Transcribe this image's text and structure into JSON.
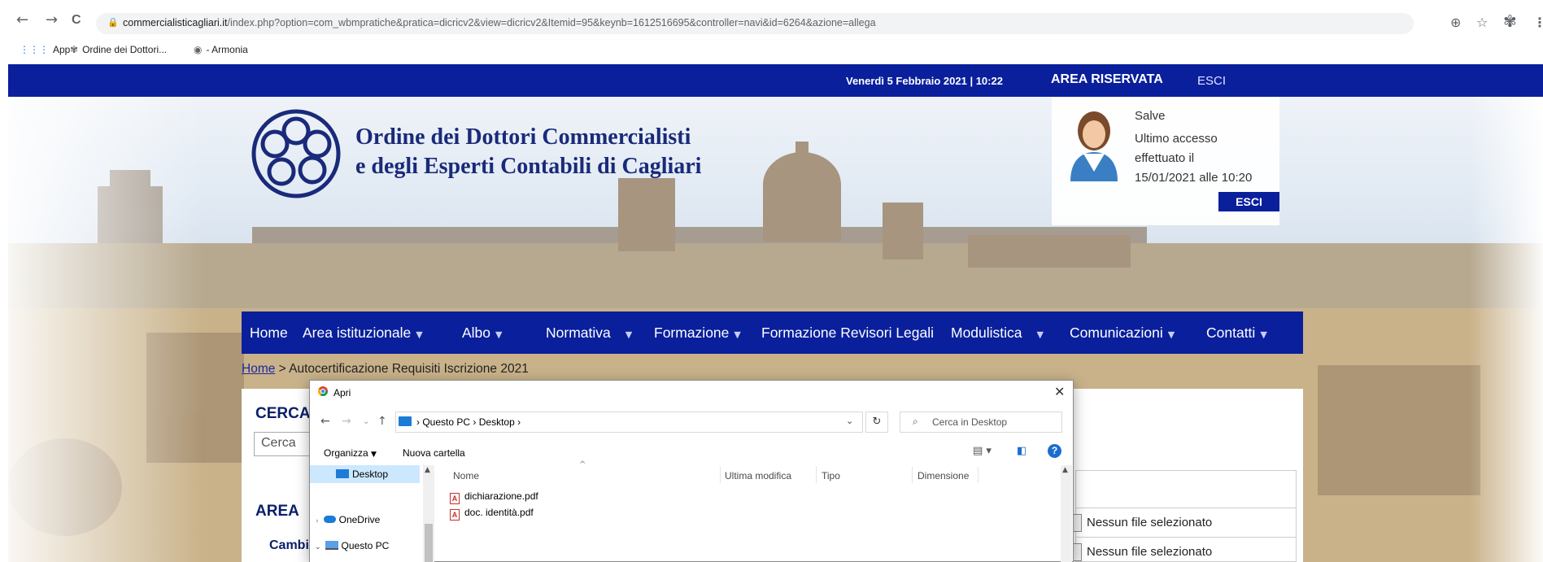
{
  "browser": {
    "back_icon": "←",
    "forward_icon": "→",
    "reload_icon": "C",
    "url_host": "commercialisticagliari.it",
    "url_path": "/index.php?option=com_wbmpratiche&pratica=dicricv2&view=dicricv2&Itemid=95&keynb=1612516695&controller=navi&id=6264&azione=allega",
    "bookmarks": [
      "App",
      "Ordine dei Dottori...",
      "- Armonia"
    ]
  },
  "site": {
    "topbar": {
      "date": "Venerdì 5 Febbraio 2021 | 10:22",
      "area": "AREA RISERVATA",
      "logout": "ESCI"
    },
    "logo": {
      "line1": "Ordine dei Dottori Commercialisti",
      "line2": "e degli Esperti Contabili di Cagliari"
    },
    "user": {
      "greeting": "Salve",
      "line1": "Ultimo accesso",
      "line2": "effettuato il",
      "line3": "15/01/2021 alle 10:20",
      "button": "ESCI"
    },
    "nav": [
      {
        "label": "Home"
      },
      {
        "label": "Area istituzionale"
      },
      {
        "label": "Albo"
      },
      {
        "label": "Normativa"
      },
      {
        "label": "Formazione"
      },
      {
        "label": "Formazione Revisori Legali"
      },
      {
        "label": "Modulistica"
      },
      {
        "label": "Comunicazioni"
      },
      {
        "label": "Contatti"
      }
    ],
    "breadcrumb": {
      "home": "Home",
      "separator": " > ",
      "current": "Autocertificazione Requisiti Iscrizione 2021"
    },
    "left": {
      "search_heading": "CERCA",
      "search_placeholder": "Cerca",
      "area_heading": "AREA",
      "sub_item": "Cambi"
    },
    "right": {
      "file_status_1": "Nessun file selezionato",
      "file_status_2": "Nessun file selezionato"
    }
  },
  "dialog": {
    "title": "Apri",
    "address": {
      "pc": "Questo PC",
      "sep": "›",
      "folder": "Desktop"
    },
    "search_placeholder": "Cerca in Desktop",
    "toolbar": {
      "organize": "Organizza",
      "new_folder": "Nuova cartella"
    },
    "tree": [
      "Desktop",
      "OneDrive",
      "Questo PC"
    ],
    "columns": [
      "Nome",
      "Ultima modifica",
      "Tipo",
      "Dimensione"
    ],
    "files": [
      "dichiarazione.pdf",
      "doc. identità.pdf"
    ]
  }
}
